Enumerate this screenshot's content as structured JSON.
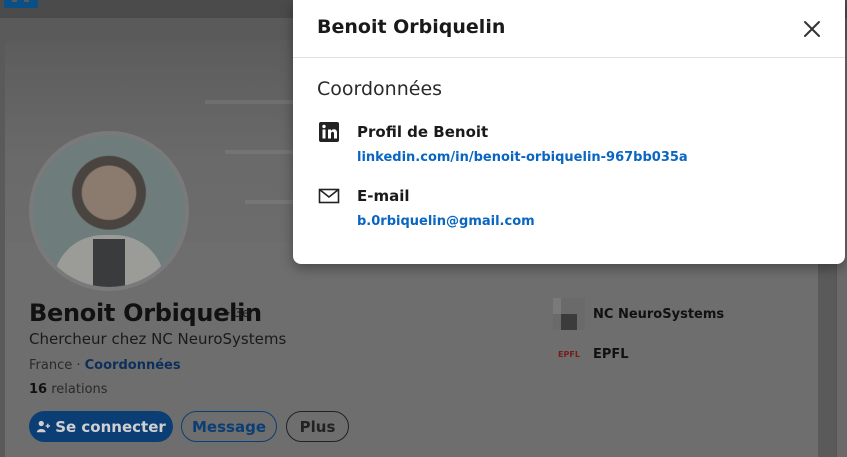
{
  "profile": {
    "name": "Benoit Orbiquelin",
    "degree": "· 3e",
    "headline": "Chercheur chez NC NeuroSystems",
    "location": "France ·",
    "contact_link": "Coordonnées",
    "relations_count": "16",
    "relations_label": "relations"
  },
  "actions": {
    "connect": "Se connecter",
    "message": "Message",
    "more": "Plus"
  },
  "companies": [
    {
      "name": "NC NeuroSystems",
      "icon": "company-logo"
    },
    {
      "name": "EPFL",
      "logo_text": "EPFL"
    }
  ],
  "modal": {
    "title": "Benoit Orbiquelin",
    "section": "Coordonnées",
    "items": [
      {
        "icon": "linkedin-icon",
        "label": "Profil de Benoit",
        "value": "linkedin.com/in/benoit-orbiquelin-967bb035a"
      },
      {
        "icon": "mail-icon",
        "label": "E-mail",
        "value": "b.0rbiquelin@gmail.com"
      }
    ]
  },
  "colors": {
    "accent": "#0a66c2",
    "primary_button": "#0b3e74",
    "overlay": "#5a5a5a"
  }
}
